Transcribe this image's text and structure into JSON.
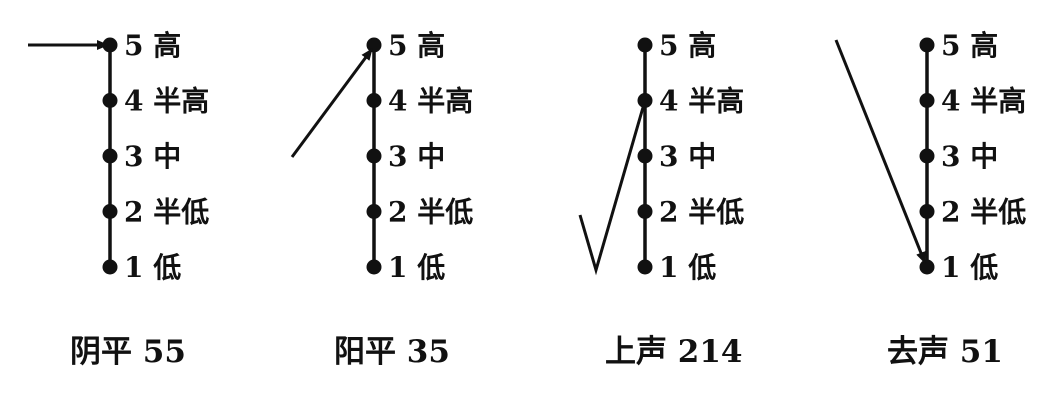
{
  "levels": [
    {
      "value": 5,
      "label": "5 高"
    },
    {
      "value": 4,
      "label": "4 半高"
    },
    {
      "value": 3,
      "label": "3 中"
    },
    {
      "value": 2,
      "label": "2 半低"
    },
    {
      "value": 1,
      "label": "1 低"
    }
  ],
  "panels": [
    {
      "caption": "阴平 55",
      "contour": [
        5,
        5
      ]
    },
    {
      "caption": "阳平 35",
      "contour": [
        3,
        5
      ]
    },
    {
      "caption": "上声 214",
      "contour": [
        2,
        1,
        4
      ]
    },
    {
      "caption": "去声 51",
      "contour": [
        5,
        1
      ]
    }
  ],
  "colors": {
    "ink": "#111111",
    "background": "#ffffff"
  }
}
